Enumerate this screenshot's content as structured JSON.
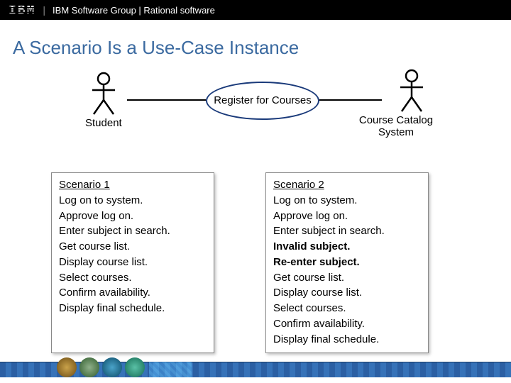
{
  "header": {
    "logo_text": "IBM",
    "text": "IBM Software Group | Rational software"
  },
  "title": "A Scenario Is a Use-Case Instance",
  "diagram": {
    "actor_left": "Student",
    "actor_right": "Course Catalog System",
    "usecase": "Register for Courses"
  },
  "scenarios": [
    {
      "title": "Scenario 1",
      "steps": [
        {
          "text": "Log on to system."
        },
        {
          "text": "Approve log on."
        },
        {
          "text": "Enter subject in search."
        },
        {
          "text": "Get course list."
        },
        {
          "text": "Display course list."
        },
        {
          "text": "Select courses."
        },
        {
          "text": "Confirm availability."
        },
        {
          "text": "Display final schedule."
        }
      ]
    },
    {
      "title": "Scenario 2",
      "steps": [
        {
          "text": "Log on to system."
        },
        {
          "text": "Approve log on."
        },
        {
          "text": "Enter subject in search."
        },
        {
          "text": "Invalid subject.",
          "bold": true
        },
        {
          "text": "Re-enter subject.",
          "bold": true
        },
        {
          "text": "Get course list."
        },
        {
          "text": "Display course list."
        },
        {
          "text": "Select courses."
        },
        {
          "text": "Confirm availability."
        },
        {
          "text": "Display final schedule."
        }
      ]
    }
  ]
}
